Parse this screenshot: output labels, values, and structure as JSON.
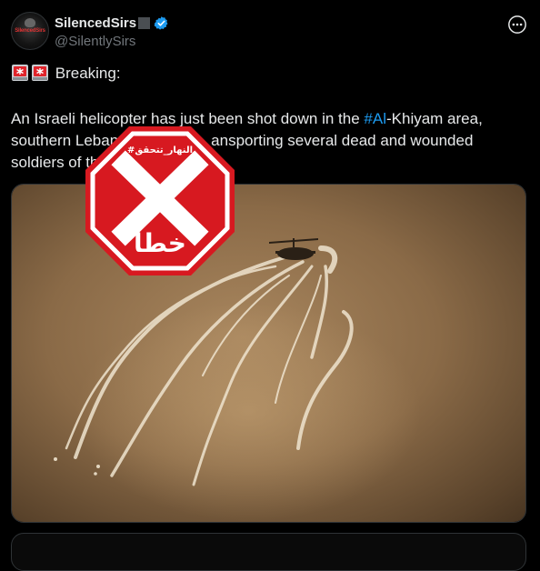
{
  "author": {
    "display_name": "SilencedSirs",
    "handle": "@SilentlySirs",
    "avatar_text": "SilencedSirs",
    "verified": true,
    "avatar_icon": "avatar-logo"
  },
  "tweet": {
    "alarm_icons": [
      "police-light-icon",
      "police-light-icon"
    ],
    "line1": "Breaking:",
    "line2_before": "An Israeli helicopter has just been shot down in the ",
    "line2_hashtag": "#Al",
    "line2_after": "-Khiyam area,",
    "line3": "southern Leban",
    "line3_tail": "ansporting several dead and wounded",
    "line4": "soldiers of th"
  },
  "stamp": {
    "top_text": "#النهار_تتحقق",
    "mark": "X",
    "bottom_text": "خطأ"
  },
  "colors": {
    "accent": "#1d9bf0",
    "stamp_red": "#d71920",
    "background": "#000000"
  }
}
